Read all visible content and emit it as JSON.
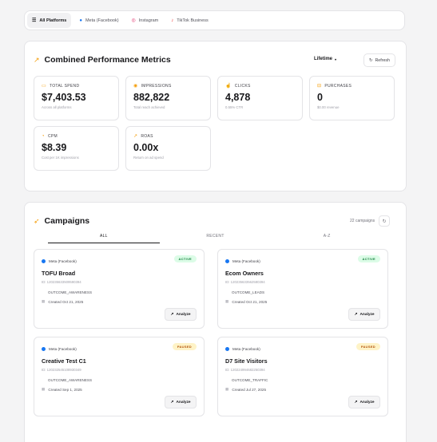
{
  "platforms": [
    {
      "label": "All Platforms",
      "icon": "list-icon",
      "active": true
    },
    {
      "label": "Meta (Facebook)",
      "icon": "meta-icon",
      "active": false
    },
    {
      "label": "Instagram",
      "icon": "instagram-icon",
      "active": false
    },
    {
      "label": "TikTok Business",
      "icon": "tiktok-icon",
      "active": false
    }
  ],
  "metrics": {
    "title": "Combined Performance Metrics",
    "period_label": "Lifetime",
    "refresh_label": "Refresh",
    "cards": [
      {
        "label": "TOTAL SPEND",
        "value": "$7,403.53",
        "sub": "Across all platforms"
      },
      {
        "label": "IMPRESSIONS",
        "value": "882,822",
        "sub": "Total reach achieved"
      },
      {
        "label": "CLICKS",
        "value": "4,878",
        "sub": "0.55% CTR"
      },
      {
        "label": "PURCHASES",
        "value": "0",
        "sub": "$0.00 revenue"
      },
      {
        "label": "CPM",
        "value": "$8.39",
        "sub": "Cost per 1K impressions"
      },
      {
        "label": "ROAS",
        "value": "0.00x",
        "sub": "Return on ad spend"
      }
    ]
  },
  "campaigns": {
    "title": "Campaigns",
    "count_label": "22 campaigns",
    "tabs": [
      "ALL",
      "RECENT",
      "A-Z"
    ],
    "analyze_label": "Analyze",
    "items": [
      {
        "platform": "Meta (Facebook)",
        "status": "ACTIVE",
        "name": "TOFU Broad",
        "id": "ID: 120235633509590394",
        "objective": "OUTCOME_AWARENESS",
        "created": "Created Oct 21, 2025"
      },
      {
        "platform": "Meta (Facebook)",
        "status": "ACTIVE",
        "name": "Ecom Owners",
        "id": "ID: 120235633562580394",
        "objective": "OUTCOME_LEADS",
        "created": "Created Oct 21, 2025"
      },
      {
        "platform": "Meta (Facebook)",
        "status": "PAUSED",
        "name": "Creative Test C1",
        "id": "ID: 120232545108930349",
        "objective": "OUTCOME_AWARENESS",
        "created": "Created Sep 1, 2025"
      },
      {
        "platform": "Meta (Facebook)",
        "status": "PAUSED",
        "name": "D7 Site Visitors",
        "id": "ID: 120224994682250394",
        "objective": "OUTCOME_TRAFFIC",
        "created": "Created Jul 27, 2025"
      }
    ]
  }
}
